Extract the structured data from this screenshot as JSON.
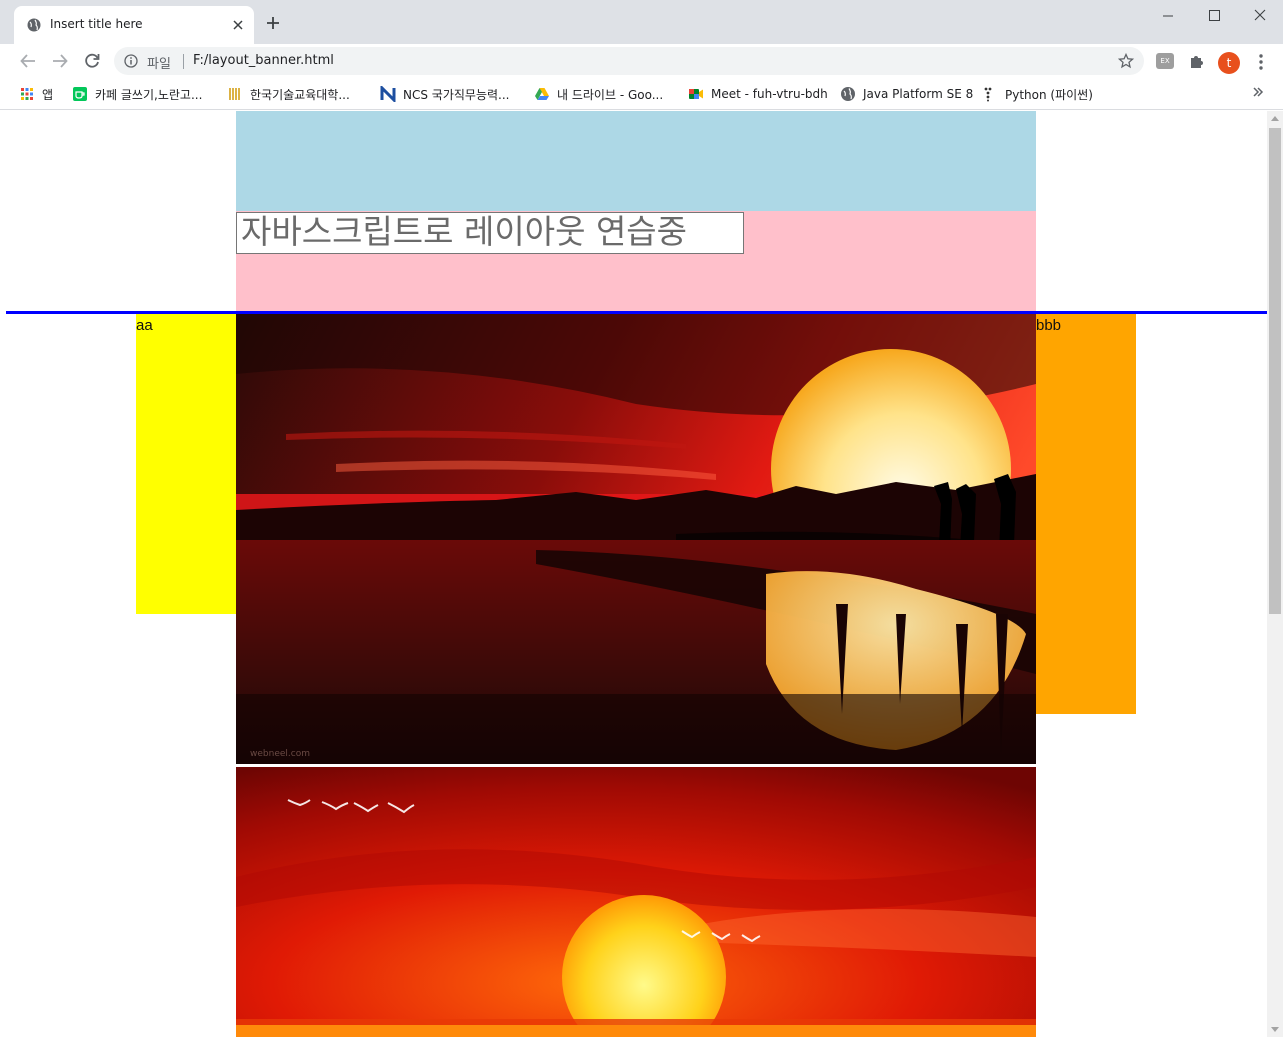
{
  "browser": {
    "tab_title": "Insert title here",
    "address_scheme": "파일",
    "address_url": "F:/layout_banner.html",
    "ext_label": "EX",
    "profile_initial": "t"
  },
  "bookmarks": [
    {
      "label": "앱",
      "icon": "apps-grid-icon"
    },
    {
      "label": "카페 글쓰기,노란고...",
      "icon": "cafe-icon"
    },
    {
      "label": "한국기술교육대학...",
      "icon": "university-icon"
    },
    {
      "label": "NCS 국가직무능력...",
      "icon": "ncs-icon"
    },
    {
      "label": "내 드라이브 - Goo...",
      "icon": "drive-icon"
    },
    {
      "label": "Meet - fuh-vtru-bdh",
      "icon": "meet-icon"
    },
    {
      "label": "Java Platform SE 8",
      "icon": "globe-icon"
    },
    {
      "label": "Python (파이썬)",
      "icon": "python-icon"
    }
  ],
  "page": {
    "title_input_value": "자바스크립트로 레이아웃 연습중",
    "left_banner_label": "aa",
    "right_banner_label": "bbb",
    "image_1_watermark": "webneel.com"
  },
  "colors": {
    "header_top": "#add8e6",
    "header_bottom": "#ffc0cb",
    "divider": "#0000ff",
    "left_banner": "#ffff00",
    "right_banner": "#ffa500"
  }
}
